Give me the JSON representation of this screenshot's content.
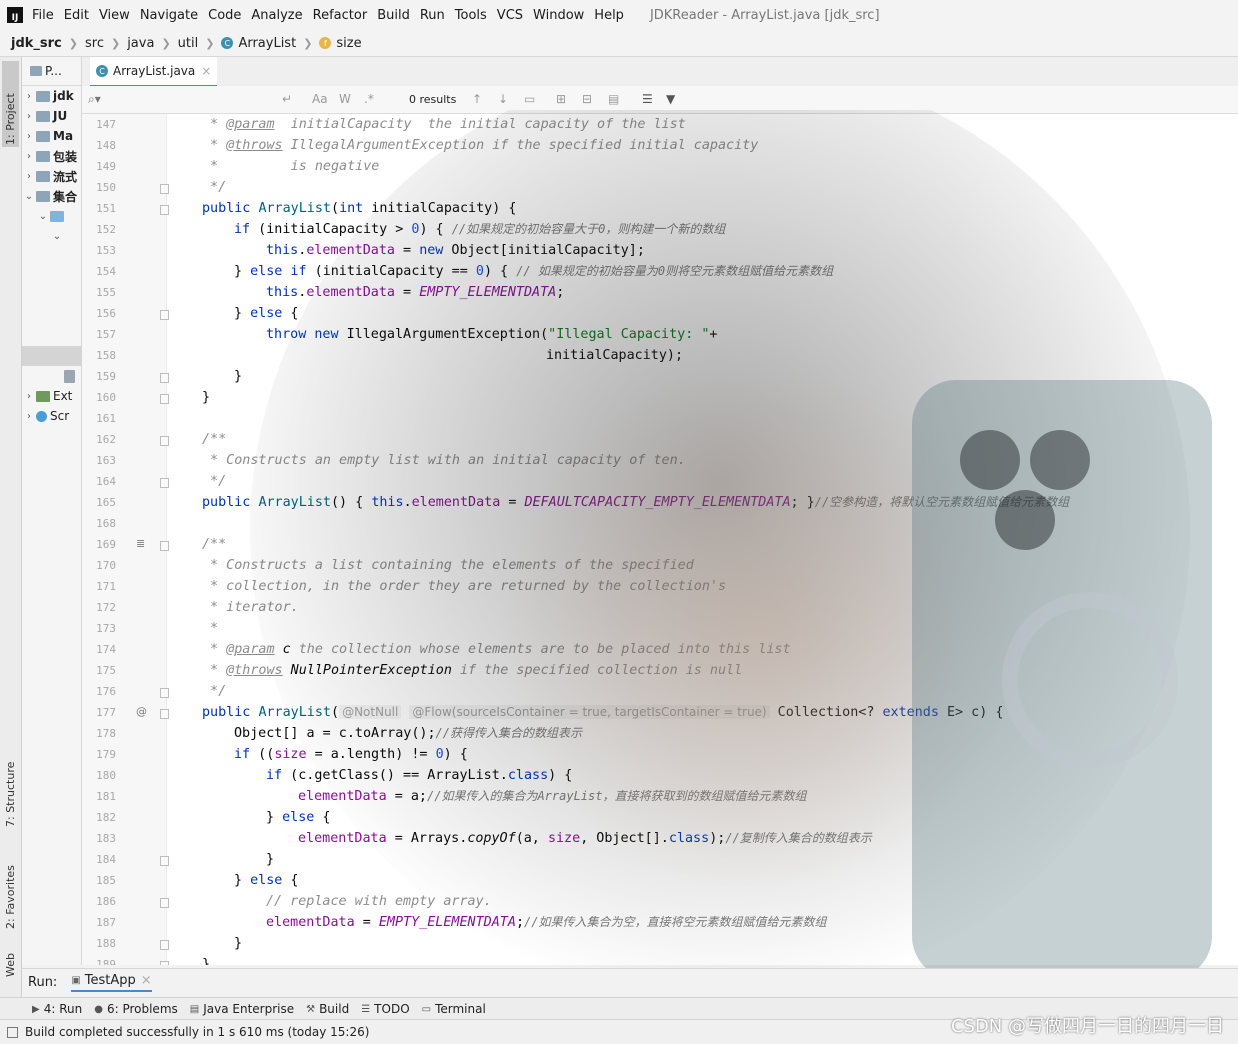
{
  "menubar": {
    "items": [
      "File",
      "Edit",
      "View",
      "Navigate",
      "Code",
      "Analyze",
      "Refactor",
      "Build",
      "Run",
      "Tools",
      "VCS",
      "Window",
      "Help"
    ],
    "title": "JDKReader - ArrayList.java [jdk_src]"
  },
  "breadcrumb": {
    "items": [
      "jdk_src",
      "src",
      "java",
      "util",
      "ArrayList",
      "size"
    ]
  },
  "left_stripe": {
    "project": "1: Project",
    "structure": "7: Structure",
    "favorites": "2: Favorites",
    "web": "Web"
  },
  "project_panel": {
    "header": "P...",
    "rows": [
      "jdk",
      "JU",
      "Ma",
      "包装",
      "流式",
      "集合",
      "",
      "",
      "Ext",
      "Scr"
    ]
  },
  "editor_tab": {
    "label": "ArrayList.java"
  },
  "search": {
    "results": "0 results",
    "aa": "Aa",
    "w": "W",
    "regex": ".*"
  },
  "code": {
    "line_numbers": [
      "147",
      "148",
      "149",
      "150",
      "151",
      "152",
      "153",
      "154",
      "155",
      "156",
      "157",
      "158",
      "159",
      "160",
      "161",
      "162",
      "163",
      "164",
      "165",
      "168",
      "169",
      "170",
      "171",
      "172",
      "173",
      "174",
      "175",
      "176",
      "177",
      "178",
      "179",
      "180",
      "181",
      "182",
      "183",
      "184",
      "185",
      "186",
      "187",
      "188",
      "189"
    ],
    "l147": {
      "star": " * ",
      "tag": "@param",
      "rest": "  initialCapacity  the initial capacity of the list"
    },
    "l148": {
      "star": " * ",
      "tag": "@throws",
      "rest": " IllegalArgumentException if the specified initial capacity"
    },
    "l149": {
      "text": " *         is negative"
    },
    "l150": {
      "text": " */"
    },
    "l151": {
      "kw": "public ",
      "name": "ArrayList",
      "p1": "(",
      "kw2": "int",
      "rest": " initialCapacity) {"
    },
    "l152": {
      "kw": "if",
      "a": " (initialCapacity > ",
      "num": "0",
      "b": ") { ",
      "cm": "//如果规定的初始容量大于0，则构建一个新的数组"
    },
    "l153": {
      "kw": "this",
      "dot": ".",
      "fd": "elementData",
      "eq": " = ",
      "kw2": "new",
      "rest": " Object[initialCapacity];"
    },
    "l154": {
      "a": "} ",
      "kw": "else if",
      "b": " (initialCapacity == ",
      "num": "0",
      "c": ") { ",
      "cm": "// 如果规定的初始容量为0则将空元素数组赋值给元素数组"
    },
    "l155": {
      "kw": "this",
      "dot": ".",
      "fd": "elementData",
      "eq": " = ",
      "sf": "EMPTY_ELEMENTDATA",
      "end": ";"
    },
    "l156": {
      "a": "} ",
      "kw": "else",
      "b": " {"
    },
    "l157": {
      "kw": "throw",
      "sp": " ",
      "kw2": "new",
      "a": " IllegalArgumentException(",
      "st": "\"Illegal Capacity: \"",
      "b": "+"
    },
    "l158": {
      "text": "initialCapacity);"
    },
    "l159": {
      "text": "}"
    },
    "l160": {
      "text": "}"
    },
    "l162": {
      "text": "/**"
    },
    "l163": {
      "text": " * Constructs an empty list with an initial capacity of ten."
    },
    "l164": {
      "text": " */"
    },
    "l165": {
      "kw": "public ",
      "name": "ArrayList",
      "a": "() { ",
      "kw2": "this",
      "dot": ".",
      "fd": "elementData",
      "eq": " = ",
      "sf": "DEFAULTCAPACITY_EMPTY_ELEMENTDATA",
      "b": "; }",
      "cm": "//空参构造，将默认空元素数组赋值给元素数组"
    },
    "l169": {
      "text": "/**"
    },
    "l170": {
      "text": " * Constructs a list containing the elements of the specified"
    },
    "l171": {
      "text": " * collection, in the order they are returned by the collection's"
    },
    "l172": {
      "text": " * iterator."
    },
    "l173": {
      "text": " *"
    },
    "l174": {
      "star": " * ",
      "tag": "@param",
      "c": " c",
      "rest": " the collection whose elements are to be placed into this list"
    },
    "l175": {
      "star": " * ",
      "tag": "@throws",
      "ex": " NullPointerException",
      "rest": " if the specified collection is null"
    },
    "l176": {
      "text": " */"
    },
    "l177": {
      "kw": "public ",
      "name": "ArrayList",
      "a": "(",
      "ann1": "@NotNull",
      "ann2": "@Flow(sourceIsContainer = true, targetIsContainer = true)",
      "b": " Collection<? ",
      "kw2": "extends",
      "c": " E> c) {"
    },
    "l178": {
      "a": "Object[] a = c.toArray();",
      "cm": "//获得传入集合的数组表示"
    },
    "l179": {
      "kw": "if",
      "a": " ((",
      "fd": "size",
      "b": " = a.length) != ",
      "num": "0",
      "c": ") {"
    },
    "l180": {
      "kw": "if",
      "a": " (c.getClass() == ArrayList.",
      "kw2": "class",
      "b": ") {"
    },
    "l181": {
      "fd": "elementData",
      "a": " = a;",
      "cm": "//如果传入的集合为ArrayList，直接将获取到的数组赋值给元素数组"
    },
    "l182": {
      "a": "} ",
      "kw": "else",
      "b": " {"
    },
    "l183": {
      "fd": "elementData",
      "a": " = Arrays.",
      "it": "copyOf",
      "b": "(a, ",
      "fd2": "size",
      "c": ", Object[].",
      "kw": "class",
      "d": ");",
      "cm": "//复制传入集合的数组表示"
    },
    "l184": {
      "text": "}"
    },
    "l185": {
      "a": "} ",
      "kw": "else",
      "b": " {"
    },
    "l186": {
      "text": "// replace with empty array."
    },
    "l187": {
      "fd": "elementData",
      "a": " = ",
      "sf": "EMPTY_ELEMENTDATA",
      "b": ";",
      "cm": "//如果传入集合为空，直接将空元素数组赋值给元素数组"
    },
    "l188": {
      "text": "}"
    },
    "l189": {
      "text": "}"
    }
  },
  "run_bar": {
    "label": "Run:",
    "config": "TestApp"
  },
  "bottom_tabs": [
    "4: Run",
    "6: Problems",
    "Java Enterprise",
    "Build",
    "TODO",
    "Terminal"
  ],
  "status": {
    "message": "Build completed successfully in 1 s 610 ms (today 15:26)"
  },
  "watermark": "CSDN @写做四月一日的四月一日",
  "colors": {
    "keyword": "#0033b3",
    "comment": "#8c8c8c",
    "string": "#067d17",
    "number": "#1750eb",
    "field": "#871094",
    "tab_accent": "#4a88c7"
  }
}
